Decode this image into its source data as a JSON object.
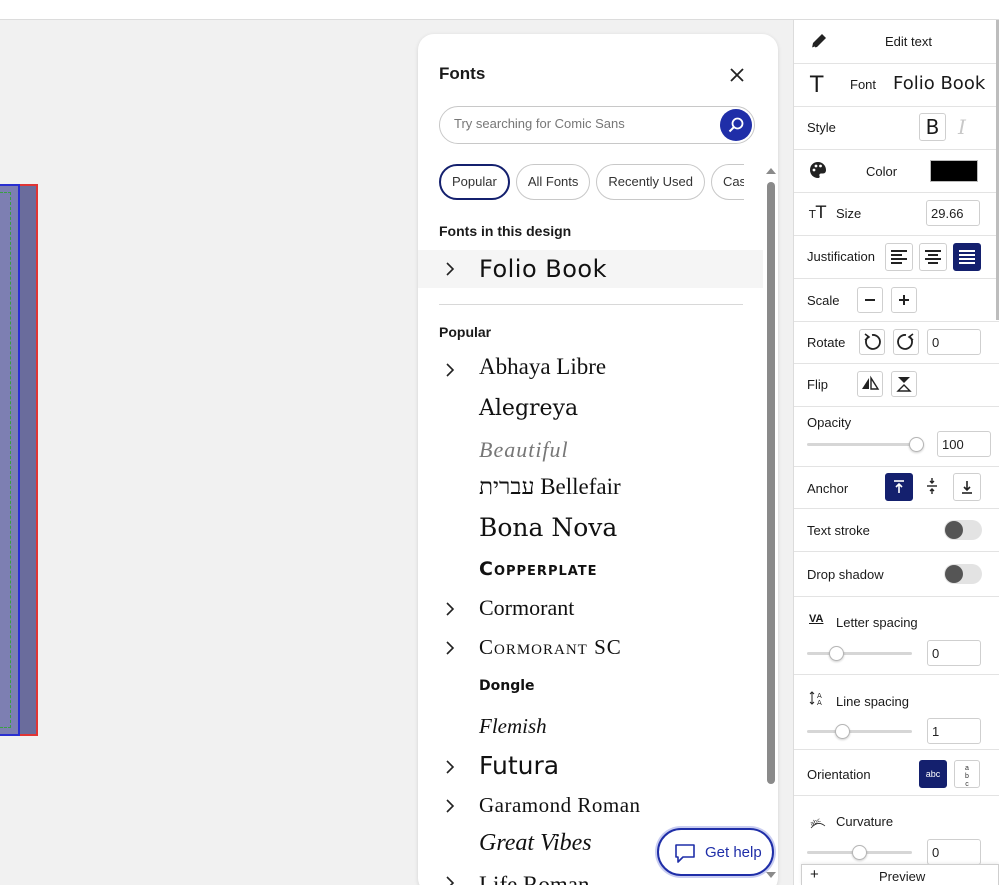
{
  "fonts_panel": {
    "title": "Fonts",
    "search_placeholder": "Try searching for Comic Sans",
    "tabs": [
      "Popular",
      "All Fonts",
      "Recently Used",
      "Casual"
    ],
    "section_design": "Fonts in this design",
    "design_font": "Folio Book",
    "section_popular": "Popular",
    "fonts": [
      "Abhaya Libre",
      "Alegreya",
      "Beautiful",
      "עברית Bellefair",
      "Bona Nova",
      "Copperplate",
      "Cormorant",
      "Cormorant SC",
      "Dongle",
      "Flemish",
      "Futura",
      "Garamond Roman",
      "Great Vibes",
      "Life Roman"
    ]
  },
  "help": {
    "label": "Get help"
  },
  "right_panel": {
    "edit_text": "Edit text",
    "font_label": "Font",
    "font_value": "Folio Book",
    "style_label": "Style",
    "bold_glyph": "B",
    "italic_glyph": "I",
    "color_label": "Color",
    "color_value": "#000000",
    "size_label": "Size",
    "size_value": "29.66",
    "justification_label": "Justification",
    "scale_label": "Scale",
    "rotate_label": "Rotate",
    "rotate_value": "0",
    "flip_label": "Flip",
    "opacity_label": "Opacity",
    "opacity_value": "100",
    "anchor_label": "Anchor",
    "text_stroke_label": "Text stroke",
    "drop_shadow_label": "Drop shadow",
    "letter_spacing_label": "Letter spacing",
    "letter_spacing_icon": "VA",
    "letter_spacing_value": "0",
    "line_spacing_label": "Line spacing",
    "line_spacing_value": "1",
    "orientation_label": "Orientation",
    "orientation_h": "abc",
    "curvature_label": "Curvature",
    "curvature_value": "0",
    "preview_label": "Preview",
    "preview_plus": "+"
  },
  "colors": {
    "accent": "#1f2ea8",
    "selected": "#14206e"
  }
}
